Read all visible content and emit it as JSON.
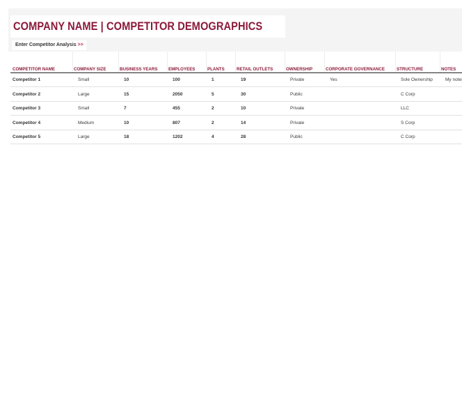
{
  "header": {
    "title": "COMPANY NAME | COMPETITOR DEMOGRAPHICS",
    "nav_link_label": "Enter Competitor Analysis",
    "nav_link_arrow": ">>"
  },
  "colors": {
    "accent": "#8b1a3a",
    "link_arrow": "#b0223e",
    "band": "#f4f4f4"
  },
  "table": {
    "columns": [
      "COMPETITOR NAME",
      "COMPANY SIZE",
      "BUSINESS YEARS",
      "EMPLOYEES",
      "PLANTS",
      "RETAIL OUTLETS",
      "OWNERSHIP",
      "CORPORATE GOVERNANCE",
      "STRUCTURE",
      "NOTES"
    ],
    "rows": [
      [
        "Competitor 1",
        "Small",
        "10",
        "100",
        "1",
        "19",
        "Private",
        "Yes",
        "Sole Ownership",
        "My notes"
      ],
      [
        "Competitor 2",
        "Large",
        "15",
        "2050",
        "5",
        "30",
        "Public",
        "",
        "C Corp",
        ""
      ],
      [
        "Competitor 3",
        "Small",
        "7",
        "455",
        "2",
        "10",
        "Private",
        "",
        "LLC",
        ""
      ],
      [
        "Competitor 4",
        "Medium",
        "10",
        "807",
        "2",
        "14",
        "Private",
        "",
        "S Corp",
        ""
      ],
      [
        "Competitor 5",
        "Large",
        "18",
        "1202",
        "4",
        "28",
        "Public",
        "",
        "C Corp",
        ""
      ]
    ]
  }
}
